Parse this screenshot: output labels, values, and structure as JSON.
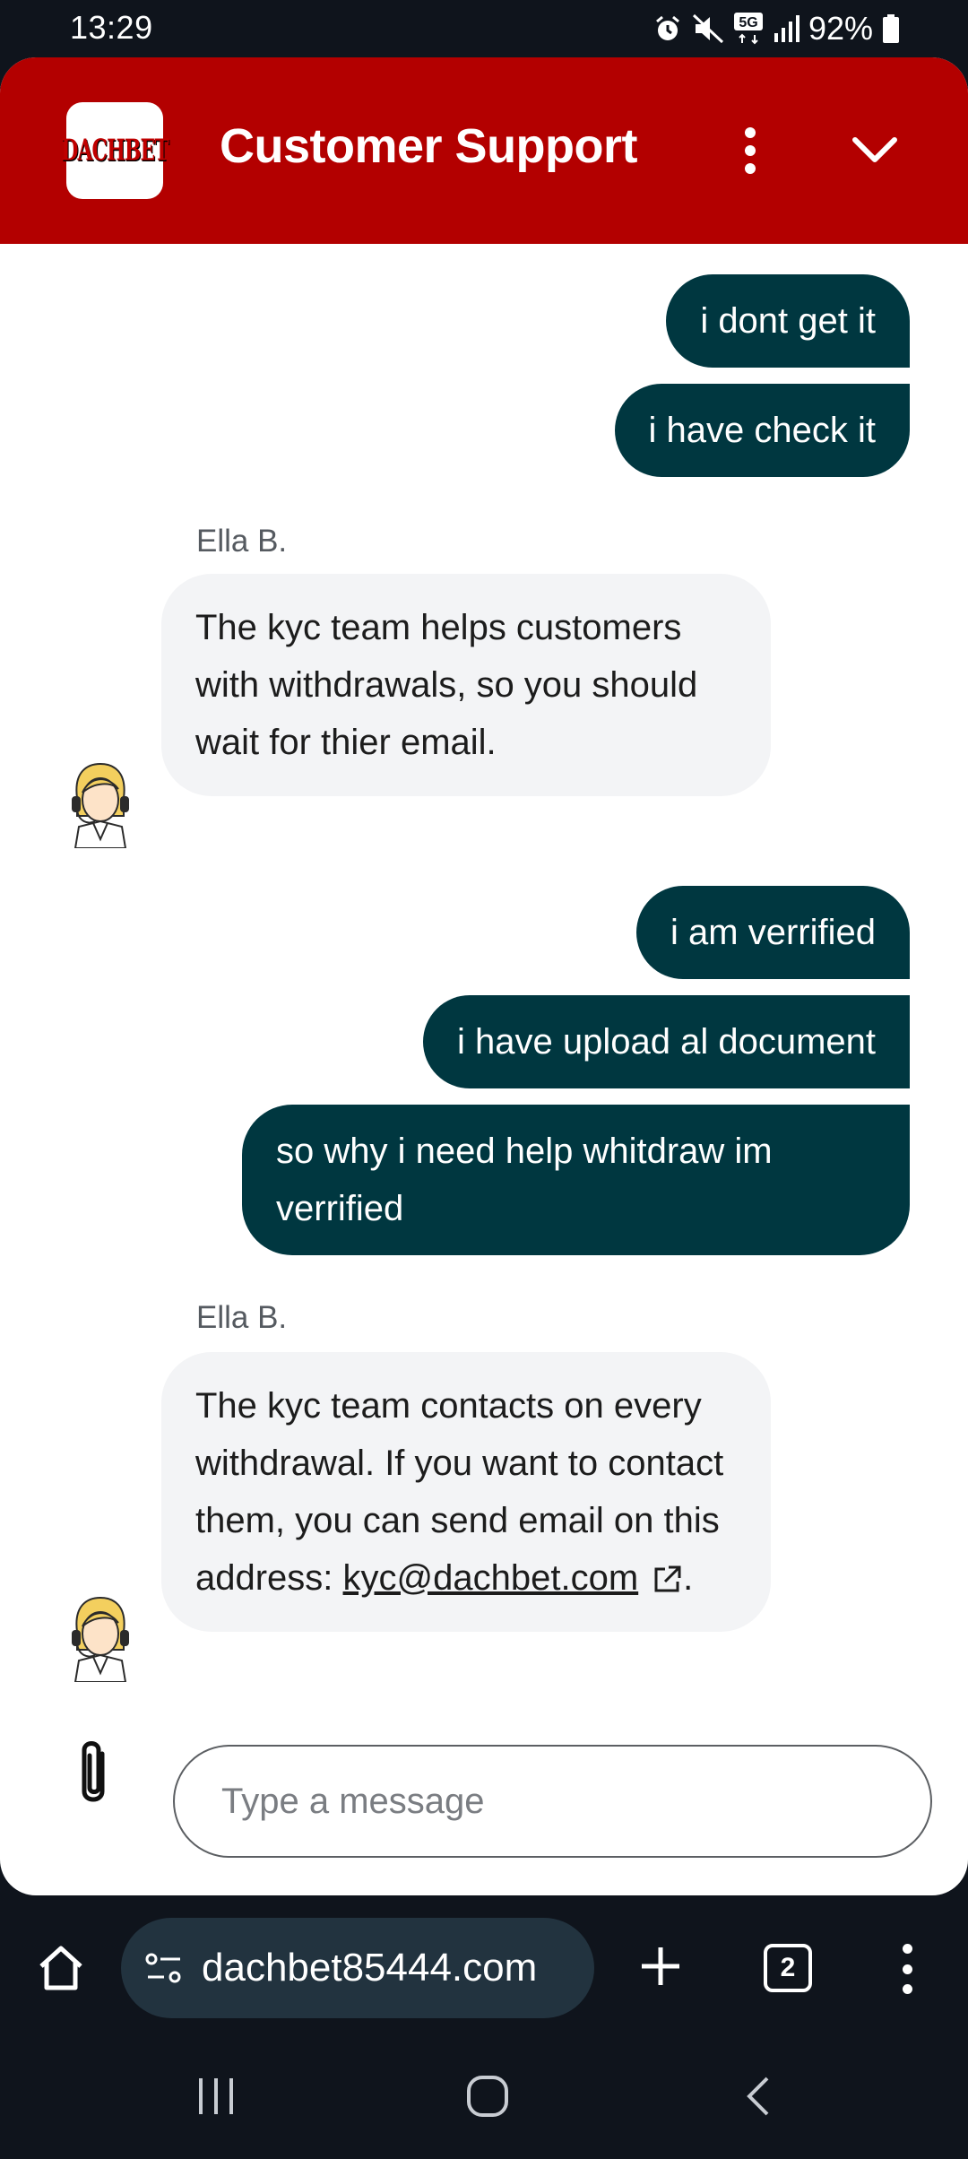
{
  "status_bar": {
    "time": "13:29",
    "network": "5G",
    "battery": "92%",
    "icons": [
      "alarm-icon",
      "mute-icon",
      "5g-icon",
      "signal-icon",
      "battery-icon"
    ]
  },
  "header": {
    "logo_text": "DACHBET",
    "title": "Customer Support",
    "color": "#b30000"
  },
  "messages": [
    {
      "direction": "out",
      "text": "i dont get it"
    },
    {
      "direction": "out",
      "text": "i have check it"
    },
    {
      "direction": "in",
      "sender": "Ella B.",
      "text": "The kyc team helps customers with withdrawals, so you should wait for thier email."
    },
    {
      "direction": "out",
      "text": "i am verrified"
    },
    {
      "direction": "out",
      "text": "i have upload al document"
    },
    {
      "direction": "out",
      "text": "so why i need help whitdraw im verrified"
    },
    {
      "direction": "in",
      "sender": "Ella B.",
      "text": "The kyc team contacts on every withdrawal. If you want to contact them, you can send email on this address:",
      "link": "kyc@dachbet.com",
      "suffix": "."
    }
  ],
  "composer": {
    "placeholder": "Type a message"
  },
  "browser": {
    "url": "dachbet85444.com",
    "tab_count": "2"
  },
  "colors": {
    "outgoing_bubble": "#003740",
    "incoming_bubble": "#f3f4f6",
    "system_bar": "#0f141c",
    "url_pill": "#22333f"
  }
}
